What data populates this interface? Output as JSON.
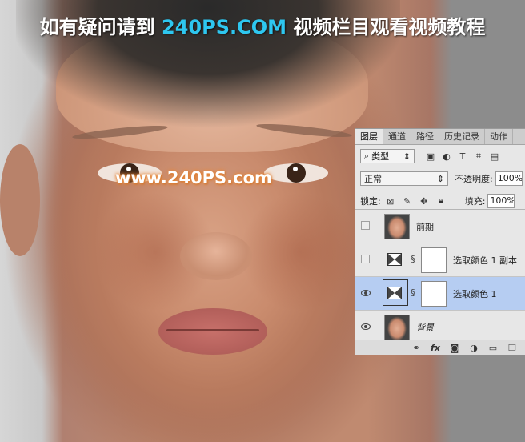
{
  "banner": {
    "before": "如有疑问请到 ",
    "site": "240PS.COM",
    "after": " 视频栏目观看视频教程"
  },
  "watermark": "www.240PS.com",
  "colors": {
    "banner_accent": "#2ec7f0",
    "selected_layer": "#b6cdf2",
    "panel_bg": "#e7e7e7"
  },
  "layers_panel": {
    "tabs": [
      "图层",
      "通道",
      "路径",
      "历史记录",
      "动作"
    ],
    "active_tab": "图层",
    "filter": {
      "kind_label": "类型",
      "icons": [
        "image-filter-icon",
        "adjustment-filter-icon",
        "type-filter-icon",
        "shape-filter-icon",
        "smart-object-filter-icon"
      ]
    },
    "blend_mode": "正常",
    "opacity_label": "不透明度:",
    "opacity_value": "100%",
    "lock_label": "锁定:",
    "fill_label": "填充:",
    "fill_value": "100%",
    "layers": [
      {
        "name": "前期",
        "visible": false,
        "type": "photo"
      },
      {
        "name": "选取颜色 1 副本",
        "visible": false,
        "type": "adjustment"
      },
      {
        "name": "选取颜色 1",
        "visible": true,
        "type": "adjustment",
        "selected": true
      },
      {
        "name": "背景",
        "visible": true,
        "type": "photo"
      }
    ],
    "footer_tools": [
      "link-layers-icon",
      "fx-icon",
      "add-mask-icon",
      "new-adjustment-icon",
      "new-group-icon",
      "new-layer-icon"
    ]
  }
}
